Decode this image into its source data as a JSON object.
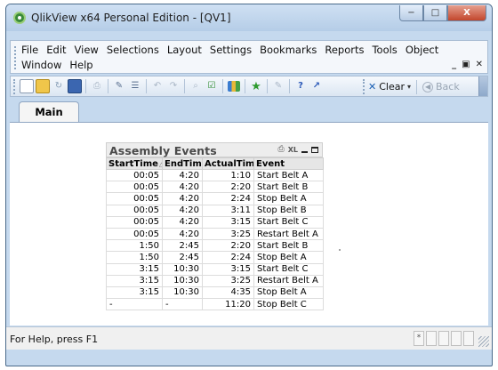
{
  "window": {
    "title": "QlikView x64 Personal Edition - [QV1]",
    "controls": {
      "minimize": "−",
      "maximize": "□",
      "close": "X"
    }
  },
  "menubar": {
    "row1": [
      "File",
      "Edit",
      "View",
      "Selections",
      "Layout",
      "Settings",
      "Bookmarks",
      "Reports",
      "Tools",
      "Object"
    ],
    "row2": [
      "Window",
      "Help"
    ],
    "mdi_controls": {
      "minimize": "_",
      "restore": "&#9645;",
      "close": "×"
    }
  },
  "toolbar": {
    "clear_label": "Clear",
    "back_label": "Back"
  },
  "tabs": [
    {
      "label": "Main"
    }
  ],
  "tablebox": {
    "caption": "Assembly Events",
    "caption_icons": {
      "print": "⎙",
      "xl": "XL"
    },
    "columns": [
      "StartTime",
      "EndTime",
      "ActualTime",
      "Event"
    ],
    "rows": [
      [
        "00:05",
        "4:20",
        "1:10",
        "Start Belt A"
      ],
      [
        "00:05",
        "4:20",
        "2:20",
        "Start Belt B"
      ],
      [
        "00:05",
        "4:20",
        "2:24",
        "Stop Belt A"
      ],
      [
        "00:05",
        "4:20",
        "3:11",
        "Stop Belt B"
      ],
      [
        "00:05",
        "4:20",
        "3:15",
        "Start Belt C"
      ],
      [
        "00:05",
        "4:20",
        "3:25",
        "Restart Belt A"
      ],
      [
        "1:50",
        "2:45",
        "2:20",
        "Start Belt B"
      ],
      [
        "1:50",
        "2:45",
        "2:24",
        "Stop Belt A"
      ],
      [
        "3:15",
        "10:30",
        "3:15",
        "Start Belt C"
      ],
      [
        "3:15",
        "10:30",
        "3:25",
        "Restart Belt A"
      ],
      [
        "3:15",
        "10:30",
        "4:35",
        "Stop Belt A"
      ],
      [
        "-",
        "-",
        "11:20",
        "Stop Belt C"
      ]
    ]
  },
  "statusbar": {
    "text": "For Help, press F1",
    "indicator": "*"
  }
}
